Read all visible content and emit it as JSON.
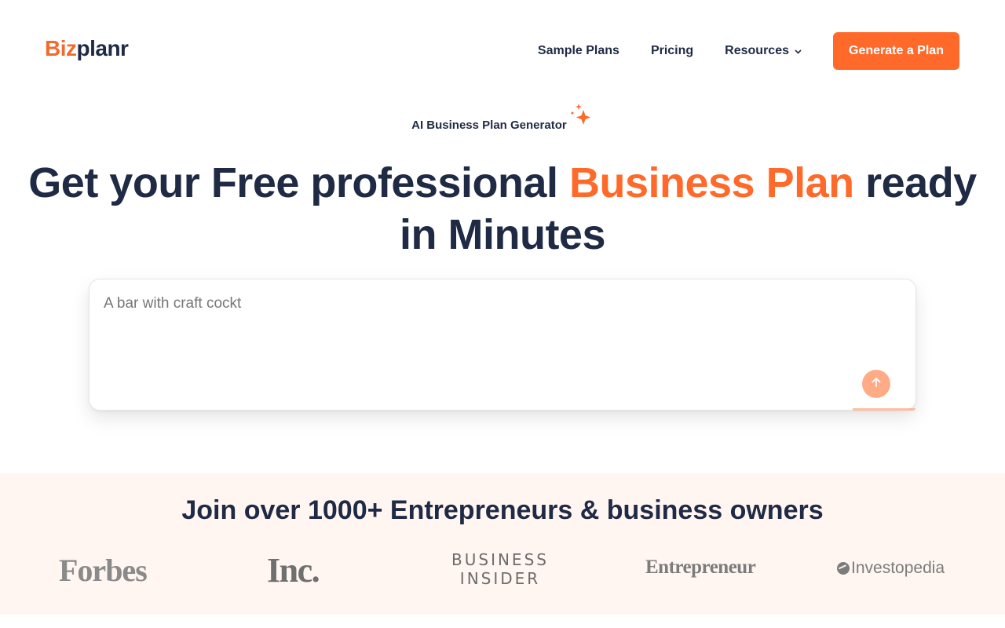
{
  "header": {
    "logo": {
      "accent": "Biz",
      "rest": "planr"
    },
    "nav": [
      {
        "label": "Sample Plans"
      },
      {
        "label": "Pricing"
      },
      {
        "label": "Resources",
        "has_dropdown": true
      }
    ],
    "cta_label": "Generate a Plan"
  },
  "hero": {
    "eyebrow": "AI Business Plan Generator",
    "title_part1": "Get your Free professional ",
    "title_highlight": "Business Plan",
    "title_part2": " ready in Minutes",
    "prompt_value": "A bar with craft cockt",
    "send_icon": "arrow-up-icon"
  },
  "social_proof": {
    "title": "Join over 1000+ Entrepreneurs & business owners",
    "brands": [
      "Forbes",
      "Inc.",
      "BUSINESS INSIDER",
      "Entrepreneur",
      "Investopedia"
    ],
    "bi_line1": "BUSINESS",
    "bi_line2": "INSIDER"
  },
  "colors": {
    "accent": "#ff6a2b",
    "navy": "#1f2a44",
    "proof_bg": "#fff5f1"
  }
}
